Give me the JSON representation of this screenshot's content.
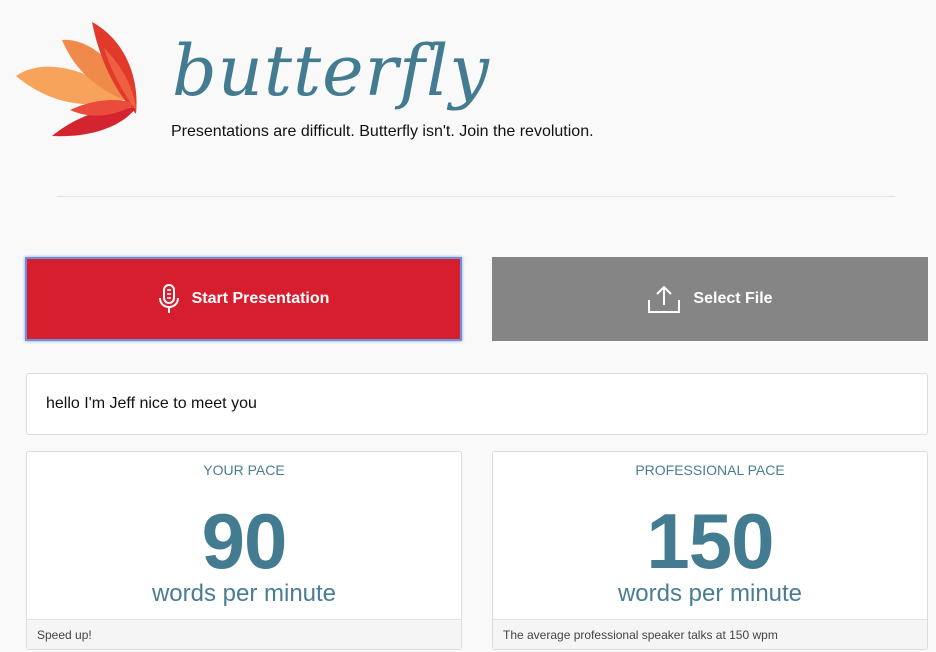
{
  "header": {
    "brand": "butterfly",
    "tagline": "Presentations are difficult. Butterfly isn't. Join the revolution.",
    "logo_icon": "butterfly-wing-logo"
  },
  "actions": {
    "start": {
      "label": "Start Presentation",
      "icon": "microphone-icon",
      "color": "#d71e2f"
    },
    "file": {
      "label": "Select File",
      "icon": "upload-icon",
      "color": "#858585"
    }
  },
  "transcript": {
    "text": "hello I'm Jeff nice to meet you"
  },
  "stats": {
    "your_pace": {
      "label": "YOUR PACE",
      "value": "90",
      "unit": "words per minute",
      "footer": "Speed up!"
    },
    "professional_pace": {
      "label": "PROFESSIONAL PACE",
      "value": "150",
      "unit": "words per minute",
      "footer": "The average professional speaker talks at 150 wpm"
    }
  },
  "colors": {
    "accent": "#437b91",
    "danger": "#d71e2f"
  }
}
